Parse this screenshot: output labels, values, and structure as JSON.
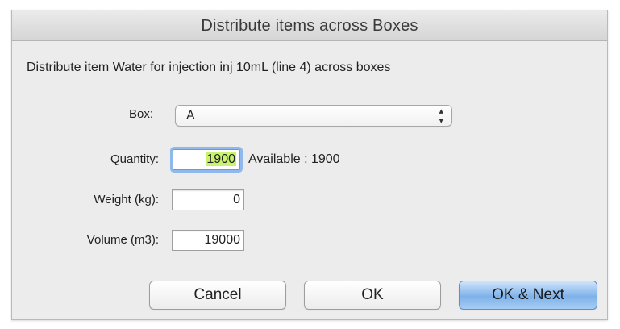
{
  "dialog": {
    "title": "Distribute items across Boxes",
    "message": "Distribute item Water for injection inj 10mL (line 4) across boxes"
  },
  "form": {
    "box_label": "Box:",
    "box_value": "A",
    "quantity_label": "Quantity:",
    "quantity_value": "1900",
    "available_text": "Available : 1900",
    "weight_label": "Weight (kg):",
    "weight_value": "0",
    "volume_label": "Volume (m3):",
    "volume_value": "19000"
  },
  "buttons": {
    "cancel": "Cancel",
    "ok": "OK",
    "ok_next": "OK & Next"
  },
  "icons": {
    "select_arrows": "up-down-arrows-icon"
  },
  "colors": {
    "selection_highlight": "#c9f26f",
    "default_button": "#7fb1ea",
    "focus_ring": "#8fb8ec"
  }
}
